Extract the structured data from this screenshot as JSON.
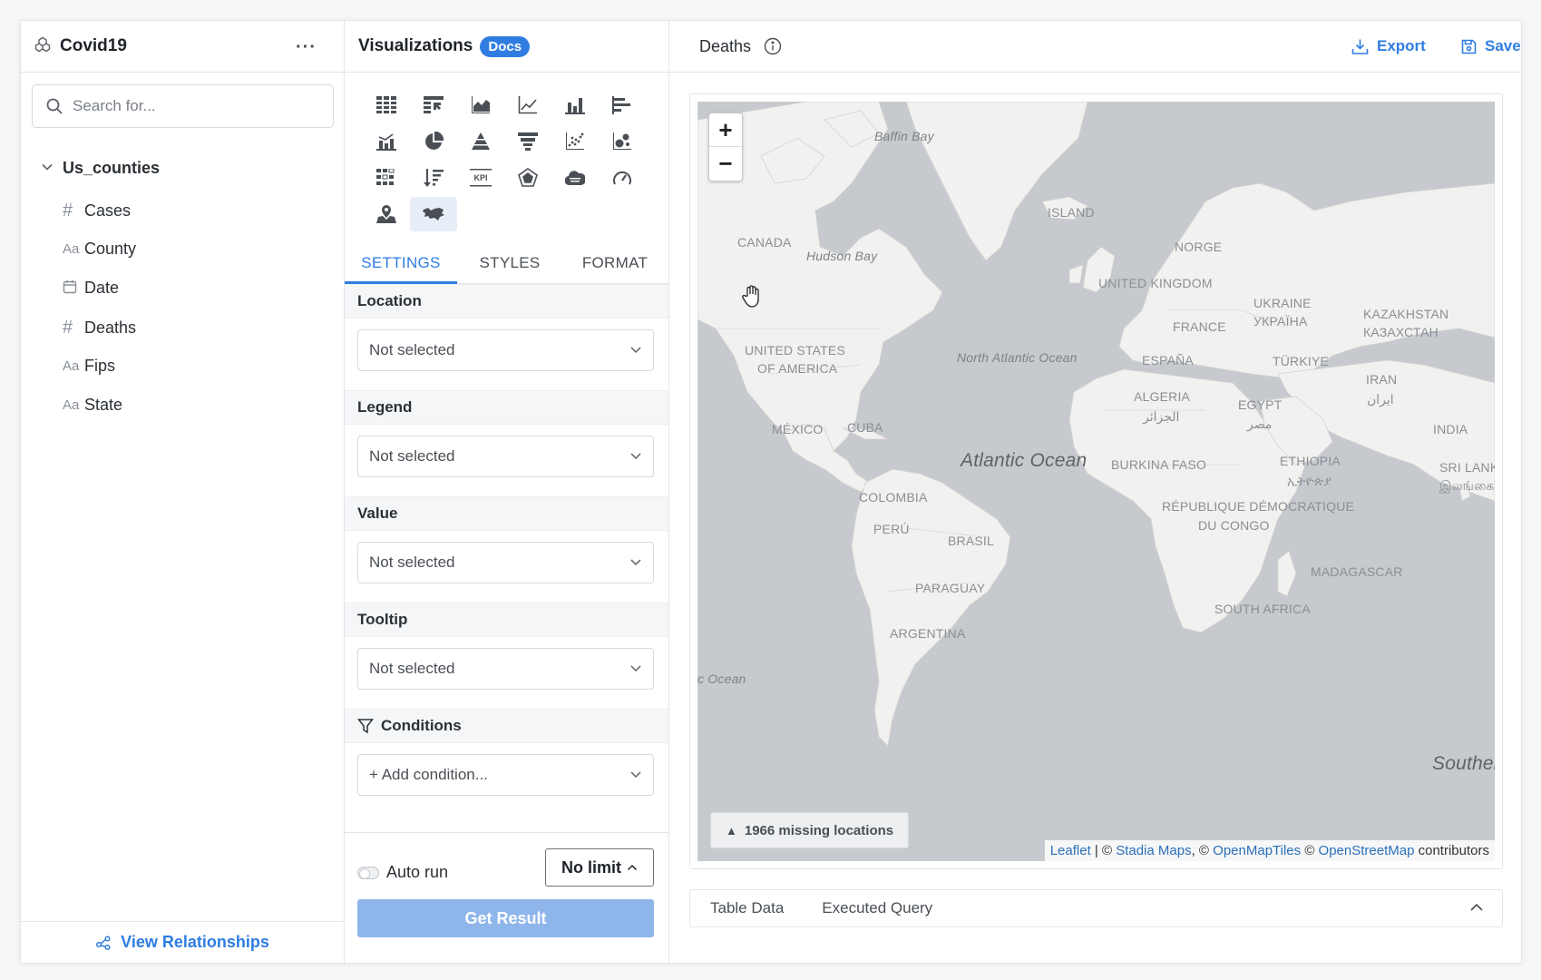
{
  "left": {
    "datasource_title": "Covid19",
    "more_label": "···",
    "search_placeholder": "Search for...",
    "table_name": "Us_counties",
    "fields": [
      {
        "type": "#",
        "name": "Cases"
      },
      {
        "type": "Aa",
        "name": "County"
      },
      {
        "type": "date",
        "name": "Date"
      },
      {
        "type": "#",
        "name": "Deaths"
      },
      {
        "type": "Aa",
        "name": "Fips"
      },
      {
        "type": "Aa",
        "name": "State"
      }
    ],
    "view_relationships": "View Relationships"
  },
  "mid": {
    "title": "Visualizations",
    "docs_badge": "Docs",
    "chart_icons": [
      "table-icon",
      "pivot-table-icon",
      "area-chart-icon",
      "line-chart-icon",
      "bar-chart-icon",
      "horizontal-bar-icon",
      "combo-chart-icon",
      "pie-chart-icon",
      "pyramid-icon",
      "funnel-icon",
      "scatter-icon",
      "bubble-icon",
      "heatmap-icon",
      "sorted-bar-icon",
      "kpi-icon",
      "radar-icon",
      "word-cloud-icon",
      "gauge-icon",
      "map-pin-icon",
      "choropleth-map-icon"
    ],
    "active_icon": "choropleth-map-icon",
    "kpi_text": "KPI",
    "tabs": [
      "SETTINGS",
      "STYLES",
      "FORMAT"
    ],
    "active_tab": "SETTINGS",
    "sections": [
      {
        "label": "Location",
        "value": "Not selected"
      },
      {
        "label": "Legend",
        "value": "Not selected"
      },
      {
        "label": "Value",
        "value": "Not selected"
      },
      {
        "label": "Tooltip",
        "value": "Not selected"
      }
    ],
    "conditions_label": "Conditions",
    "add_condition": "+ Add condition...",
    "auto_run": "Auto run",
    "limit": "No limit",
    "get_result": "Get Result"
  },
  "right": {
    "title": "Deaths",
    "export": "Export",
    "save": "Save",
    "zoom_in": "+",
    "zoom_out": "−",
    "missing_locations": "1966 missing locations",
    "attribution": {
      "leaflet": "Leaflet",
      "sep1": " | © ",
      "stadia": "Stadia Maps",
      "sep2": ", © ",
      "openmaptiles": "OpenMapTiles",
      "sep3": " © ",
      "osm": "OpenStreetMap",
      "tail": " contributors"
    },
    "map_labels": {
      "baffin": "Baffin Bay",
      "island": "ISLAND",
      "canada": "CANADA",
      "hudson": "Hudson Bay",
      "norge": "NORGE",
      "uk": "UNITED KINGDOM",
      "ukraine": "UKRAINE",
      "ukraina": "УКРАЇНА",
      "kazakhstan": "KAZAKHSTAN",
      "kazakh_cyr": "КАЗАХСТАН",
      "usa1": "UNITED STATES",
      "usa2": "OF AMERICA",
      "france": "FRANCE",
      "espana": "ESPAÑA",
      "turkiye": "TÜRKIYE",
      "north_atlantic": "North Atlantic Ocean",
      "iran": "IRAN",
      "iran_ar": "ایران",
      "algeria": "ALGERIA",
      "algeria_ar": "الجزائر",
      "egypt": "EGYPT",
      "egypt_ar": "مصر",
      "mexico": "MÉXICO",
      "cuba": "CUBA",
      "india": "INDIA",
      "atlantic": "Atlantic Ocean",
      "burkina": "BURKINA FASO",
      "ethiopia": "ETHIOPIA",
      "ethiopia_am": "ኢትዮጵያ",
      "srilanka": "SRI LANKA",
      "srilanka_ta": "இலங்கை",
      "colombia": "COLOMBIA",
      "rdc1": "RÉPUBLIQUE DÉMOCRATIQUE",
      "rdc2": "DU CONGO",
      "peru": "PERÚ",
      "brasil": "BRASIL",
      "paraguay": "PARAGUAY",
      "madagascar": "MADAGASCAR",
      "south_africa": "SOUTH AFRICA",
      "argentina": "ARGENTINA",
      "c_ocean": "c Ocean",
      "souther": "Souther"
    },
    "bottom_tabs": [
      "Table Data",
      "Executed Query"
    ]
  },
  "colors": {
    "accent": "#2f7de1",
    "land": "#f1f1ef",
    "water": "#c6cace",
    "get_result_disabled": "#8fb6ea"
  }
}
